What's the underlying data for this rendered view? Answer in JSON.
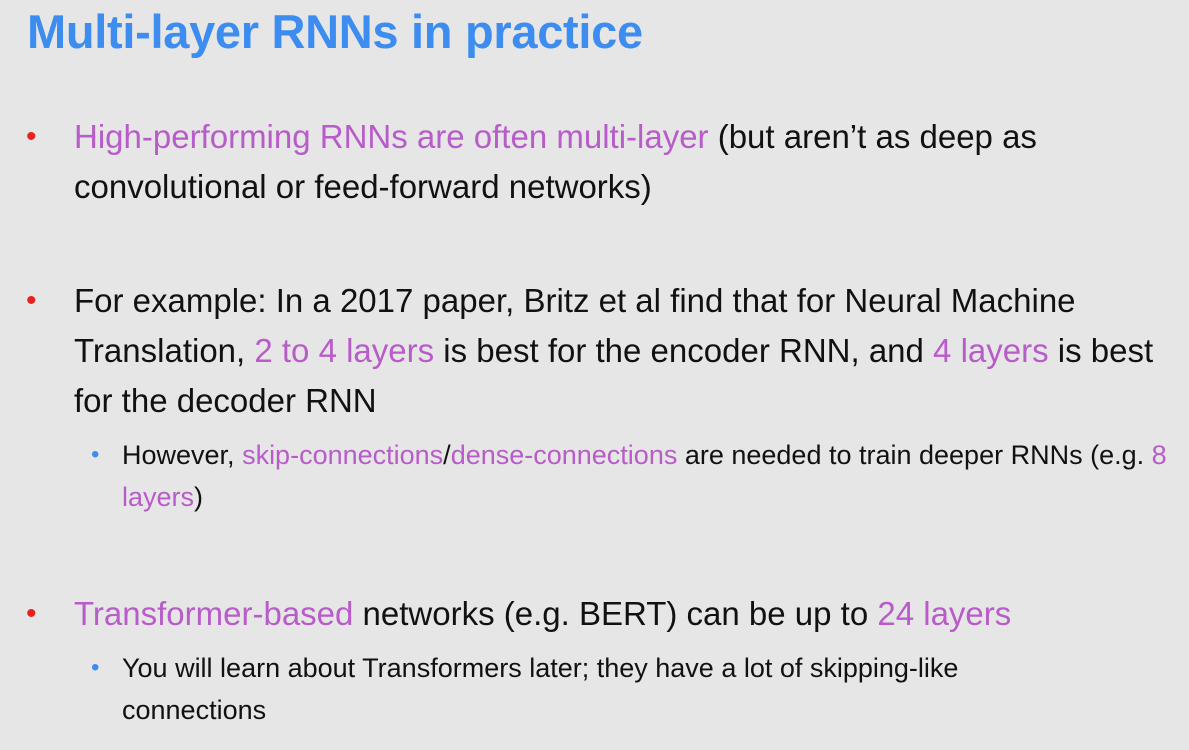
{
  "slide": {
    "title": "Multi-layer RNNs in practice",
    "bullets": [
      {
        "marker": "•",
        "parts": [
          {
            "text": "High-performing RNNs are often multi-layer",
            "highlight": true
          },
          {
            "text": " (but aren’t as deep as convolutional or feed-forward networks)",
            "highlight": false
          }
        ],
        "sub_bullets": []
      },
      {
        "marker": "•",
        "parts": [
          {
            "text": "For example: In a 2017 paper, Britz et al find that for Neural Machine Translation, ",
            "highlight": false
          },
          {
            "text": "2 to 4 layers",
            "highlight": true
          },
          {
            "text": " is best for the encoder RNN, and ",
            "highlight": false
          },
          {
            "text": "4 layers",
            "highlight": true
          },
          {
            "text": " is best for the decoder RNN",
            "highlight": false
          }
        ],
        "sub_bullets": [
          {
            "marker": "•",
            "parts": [
              {
                "text": "However, ",
                "highlight": false
              },
              {
                "text": "skip-connections",
                "highlight": true
              },
              {
                "text": "/",
                "highlight": false
              },
              {
                "text": "dense-connections",
                "highlight": true
              },
              {
                "text": " are needed to train deeper RNNs (e.g. ",
                "highlight": false
              },
              {
                "text": "8 layers",
                "highlight": true
              },
              {
                "text": ")",
                "highlight": false
              }
            ]
          }
        ]
      },
      {
        "marker": "•",
        "parts": [
          {
            "text": "Transformer-based",
            "highlight": true
          },
          {
            "text": " networks (e.g. BERT) can be up to ",
            "highlight": false
          },
          {
            "text": "24 layers",
            "highlight": true
          }
        ],
        "sub_bullets": [
          {
            "marker": "•",
            "parts": [
              {
                "text": "You will learn about Transformers later; they have a lot of skipping-like connections",
                "highlight": false
              }
            ]
          }
        ]
      }
    ],
    "colors": {
      "title": "#3d8cf0",
      "highlight": "#b75cc8",
      "bullet_marker": "#e8221c",
      "sub_bullet_marker": "#3d8cf0",
      "background": "#e7e6e6",
      "text": "#111111"
    }
  }
}
